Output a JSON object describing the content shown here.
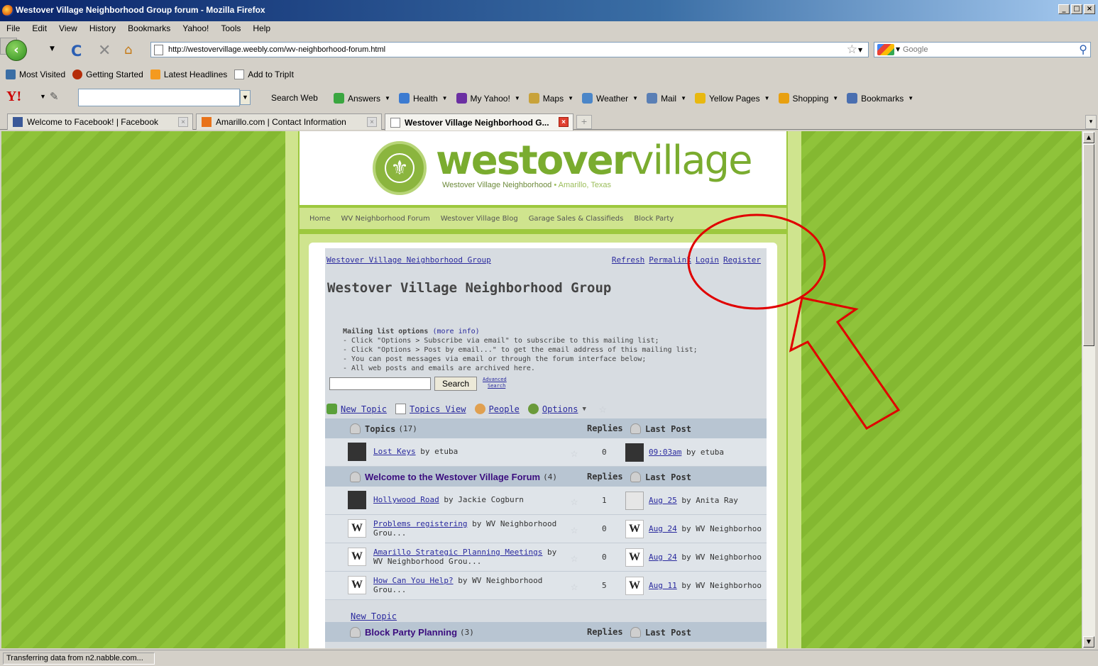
{
  "window": {
    "title": "Westover Village Neighborhood Group forum - Mozilla Firefox",
    "buttons": [
      "_",
      "□",
      "×"
    ]
  },
  "menu": [
    "File",
    "Edit",
    "View",
    "History",
    "Bookmarks",
    "Yahoo!",
    "Tools",
    "Help"
  ],
  "nav": {
    "url": "http://westovervillage.weebly.com/wv-neighborhood-forum.html",
    "search_placeholder": "Google"
  },
  "bookmarks": [
    "Most Visited",
    "Getting Started",
    "Latest Headlines",
    "Add to TripIt"
  ],
  "yahoo_toolbar": {
    "search_web": "Search Web",
    "items": [
      {
        "label": "Answers",
        "icon": "answers-icon",
        "color": "#3aa640"
      },
      {
        "label": "Health",
        "icon": "health-icon",
        "color": "#3c7bd1"
      },
      {
        "label": "My Yahoo!",
        "icon": "my-yahoo-icon",
        "color": "#6b2fa2"
      },
      {
        "label": "Maps",
        "icon": "maps-icon",
        "color": "#c8a23a"
      },
      {
        "label": "Weather",
        "icon": "weather-icon",
        "color": "#4b86c8"
      },
      {
        "label": "Mail",
        "icon": "mail-icon",
        "color": "#5a7fb5"
      },
      {
        "label": "Yellow Pages",
        "icon": "yellow-pages-icon",
        "color": "#e8b810"
      },
      {
        "label": "Shopping",
        "icon": "shopping-icon",
        "color": "#e8a010"
      },
      {
        "label": "Bookmarks",
        "icon": "bookmarks-icon",
        "color": "#4a6fb0"
      }
    ]
  },
  "tabs": [
    {
      "label": "Welcome to Facebook! | Facebook",
      "active": false
    },
    {
      "label": "Amarillo.com | Contact Information",
      "active": false
    },
    {
      "label": "Westover Village Neighborhood G...",
      "active": true
    }
  ],
  "site": {
    "logo_bold": "westover",
    "logo_light": "village",
    "logo_sub": "Westover Village Neighborhood",
    "logo_loc": "• Amarillo, Texas",
    "nav": [
      "Home",
      "WV Neighborhood Forum",
      "Westover Village Blog",
      "Garage Sales & Classifieds",
      "Block Party"
    ]
  },
  "forum": {
    "breadcrumb": "Westover Village Neighborhood Group",
    "toplinks": [
      "Refresh",
      "Permalink",
      "Login",
      "Register"
    ],
    "title": "Westover Village Neighborhood Group",
    "mailing_head": "Mailing list options",
    "mailing_more": "(more info)",
    "mailing_lines": [
      "- Click \"Options > Subscribe via email\" to subscribe to this mailing list;",
      "- Click \"Options > Post by email...\" to get the email address of this mailing list;",
      "- You can post messages via email or through the forum interface below;",
      "- All web posts and emails are archived here."
    ],
    "search_button": "Search",
    "advanced_search_1": "Advanced",
    "advanced_search_2": "Search",
    "actions": [
      "New Topic",
      "Topics View",
      "People",
      "Options"
    ],
    "topics_header": {
      "label": "Topics",
      "count": "(17)",
      "replies": "Replies",
      "last_post": "Last Post"
    },
    "topics_rows": [
      {
        "title": "Lost Keys",
        "by": "by etuba",
        "replies": "0",
        "last_link": "09:03am",
        "last_by": "by etuba"
      }
    ],
    "welcome_header": {
      "label": "Welcome to the Westover Village Forum",
      "count": "(4)",
      "replies": "Replies",
      "last_post": "Last Post"
    },
    "welcome_rows": [
      {
        "title": "Hollywood Road",
        "by": "by Jackie Cogburn",
        "replies": "1",
        "last_link": "Aug 25",
        "last_by": "by Anita Ray"
      },
      {
        "title": "Problems registering",
        "by": "by WV Neighborhood Grou...",
        "replies": "0",
        "last_link": "Aug 24",
        "last_by": "by WV Neighborhoo"
      },
      {
        "title": "Amarillo Strategic Planning Meetings",
        "by": "by WV Neighborhood Grou...",
        "replies": "0",
        "last_link": "Aug 24",
        "last_by": "by WV Neighborhoo"
      },
      {
        "title": "How Can You Help?",
        "by": "by WV Neighborhood Grou...",
        "replies": "5",
        "last_link": "Aug 11",
        "last_by": "by WV Neighborhoo"
      }
    ],
    "new_topic_link": "New Topic",
    "block_header": {
      "label": "Block Party Planning",
      "count": "(3)",
      "replies": "Replies",
      "last_post": "Last Post"
    }
  },
  "status": "Transferring data from n2.nabble.com..."
}
